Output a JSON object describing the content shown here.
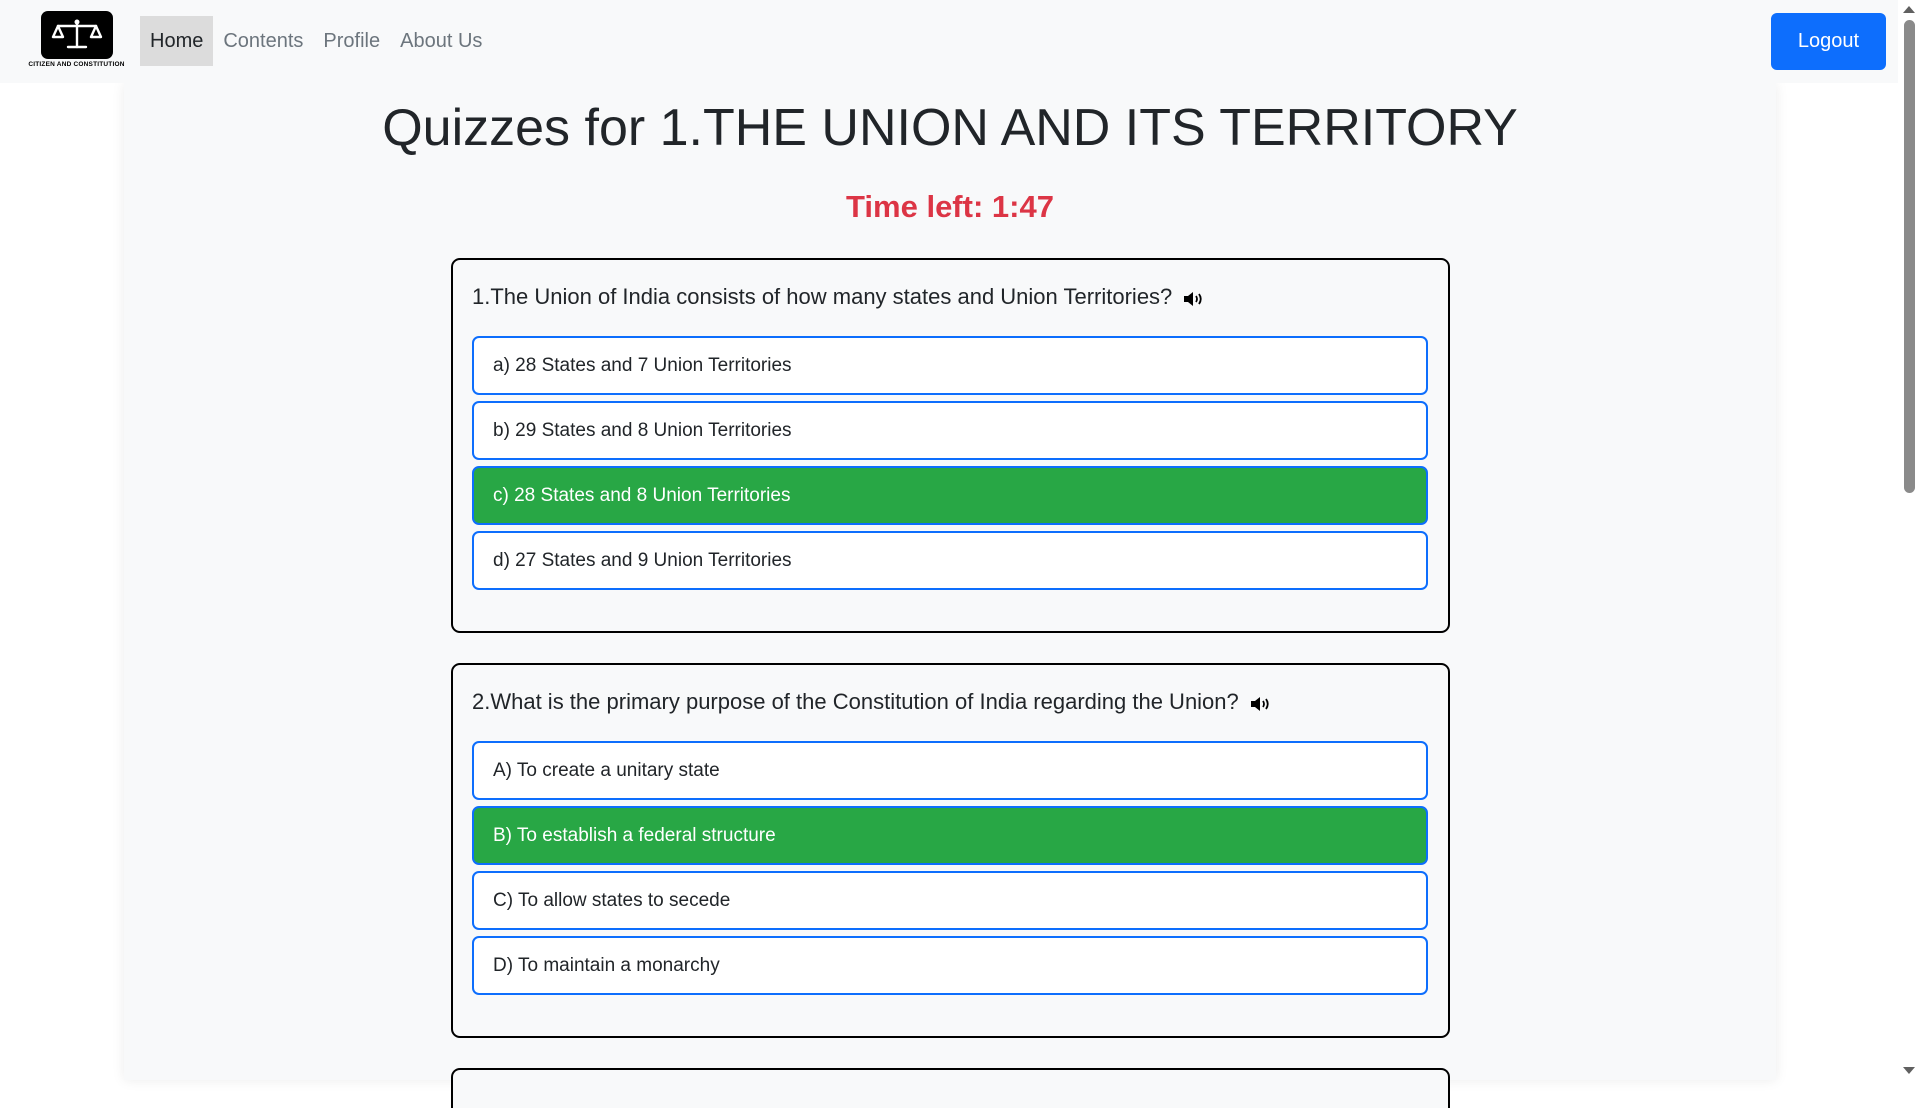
{
  "brand": {
    "logo_icon": "scales-of-justice-icon",
    "caption": "CITIZEN AND CONSTITUTION"
  },
  "nav": {
    "items": [
      {
        "label": "Home",
        "active": true
      },
      {
        "label": "Contents",
        "active": false
      },
      {
        "label": "Profile",
        "active": false
      },
      {
        "label": "About Us",
        "active": false
      }
    ],
    "logout_label": "Logout"
  },
  "page": {
    "title": "Quizzes for 1.THE UNION AND ITS TERRITORY",
    "timer": "Time left: 1:47"
  },
  "questions": [
    {
      "text": "1.The Union of India consists of how many states and Union Territories?",
      "speaker_icon": "speaker-icon",
      "options": [
        {
          "label": "a) 28 States and 7 Union Territories",
          "selected": false
        },
        {
          "label": "b) 29 States and 8 Union Territories",
          "selected": false
        },
        {
          "label": "c) 28 States and 8 Union Territories",
          "selected": true
        },
        {
          "label": "d) 27 States and 9 Union Territories",
          "selected": false
        }
      ]
    },
    {
      "text": "2.What is the primary purpose of the Constitution of India regarding the Union?",
      "speaker_icon": "speaker-icon",
      "options": [
        {
          "label": "A) To create a unitary state",
          "selected": false
        },
        {
          "label": "B) To establish a federal structure",
          "selected": true
        },
        {
          "label": "C) To allow states to secede",
          "selected": false
        },
        {
          "label": "D) To maintain a monarchy",
          "selected": false
        }
      ]
    }
  ],
  "colors": {
    "primary": "#0d6efd",
    "selected": "#28a745",
    "timer": "#dc3545",
    "navbar_bg": "#f8f9fa"
  }
}
